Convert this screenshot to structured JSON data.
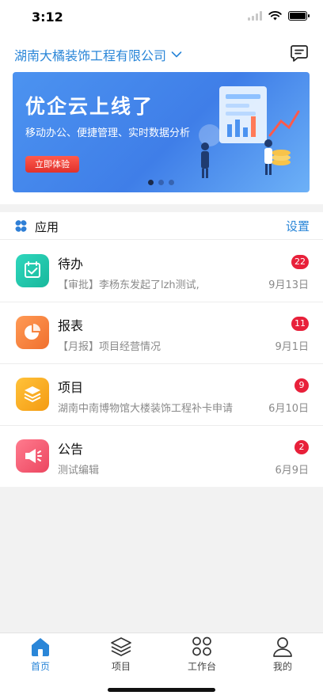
{
  "status_bar": {
    "time": "3:12"
  },
  "header": {
    "company_name": "湖南大橘装饰工程有限公司",
    "company_dropdown_icon": "chevron-down-icon",
    "message_icon": "message-icon"
  },
  "banner": {
    "title": "优企云上线了",
    "subtitle": "移动办公、便捷管理、实时数据分析",
    "button_label": "立即体验",
    "page_count": 3,
    "active_page": 1
  },
  "apps": {
    "title": "应用",
    "settings_label": "设置",
    "items": [
      {
        "title": "待办",
        "subtitle": "【审批】李杨东发起了lzh测试,",
        "date": "9月13日",
        "badge": "22",
        "icon": "todo-icon",
        "color": "#1fc5a9"
      },
      {
        "title": "报表",
        "subtitle": "【月报】项目经营情况",
        "date": "9月1日",
        "badge": "11",
        "icon": "pie-chart-icon",
        "color": "#f47b3a"
      },
      {
        "title": "项目",
        "subtitle": "湖南中南博物馆大楼装饰工程补卡申请",
        "date": "6月10日",
        "badge": "9",
        "icon": "layers-icon",
        "color": "#f5a623"
      },
      {
        "title": "公告",
        "subtitle": "测试编辑",
        "date": "6月9日",
        "badge": "2",
        "icon": "megaphone-icon",
        "color": "#f0566e"
      }
    ]
  },
  "tabbar": {
    "active": 0,
    "tabs": [
      {
        "label": "首页",
        "icon": "home-icon"
      },
      {
        "label": "项目",
        "icon": "layers-icon"
      },
      {
        "label": "工作台",
        "icon": "workbench-icon"
      },
      {
        "label": "我的",
        "icon": "user-icon"
      }
    ]
  },
  "colors": {
    "accent": "#2a86d8",
    "badge": "#e8203a"
  }
}
